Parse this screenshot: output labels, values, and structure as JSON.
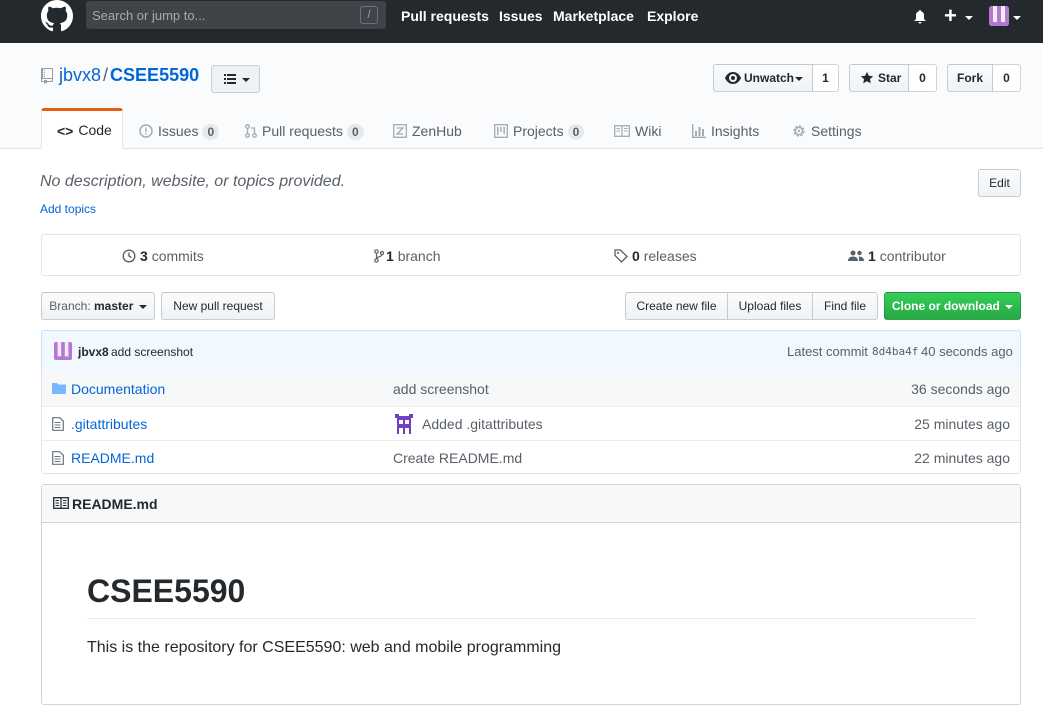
{
  "header": {
    "search_placeholder": "Search or jump to...",
    "search_shortcut": "/",
    "nav": [
      "Pull requests",
      "Issues",
      "Marketplace",
      "Explore"
    ],
    "plus_label": "+"
  },
  "repo": {
    "owner": "jbvx8",
    "separator": "/",
    "name": "CSEE5590",
    "watch_label": "Unwatch",
    "watch_count": "1",
    "star_label": "Star",
    "star_count": "0",
    "fork_label": "Fork",
    "fork_count": "0"
  },
  "tabs": [
    {
      "label": "Code",
      "icon": "code-icon"
    },
    {
      "label": "Issues",
      "count": "0",
      "icon": "issue-icon"
    },
    {
      "label": "Pull requests",
      "count": "0",
      "icon": "pull-request-icon"
    },
    {
      "label": "ZenHub",
      "icon": "zenhub-icon"
    },
    {
      "label": "Projects",
      "count": "0",
      "icon": "project-icon"
    },
    {
      "label": "Wiki",
      "icon": "book-icon"
    },
    {
      "label": "Insights",
      "icon": "graph-icon"
    },
    {
      "label": "Settings",
      "icon": "gear-icon"
    }
  ],
  "about": {
    "description": "No description, website, or topics provided.",
    "add_topics": "Add topics",
    "edit_label": "Edit"
  },
  "summary": {
    "commits_num": "3",
    "commits_label": "commits",
    "branch_num": "1",
    "branch_label": "branch",
    "releases_num": "0",
    "releases_label": "releases",
    "contributors_num": "1",
    "contributors_label": "contributor"
  },
  "toolbar": {
    "branch_prefix": "Branch:",
    "branch_name": "master",
    "new_pr": "New pull request",
    "create_file": "Create new file",
    "upload_files": "Upload files",
    "find_file": "Find file",
    "clone": "Clone or download"
  },
  "latest_commit": {
    "author": "jbvx8",
    "message": "add screenshot",
    "label": "Latest commit",
    "sha": "8d4ba4f",
    "age": "40 seconds ago"
  },
  "files": [
    {
      "name": "Documentation",
      "type": "folder",
      "message": "add screenshot",
      "age": "36 seconds ago"
    },
    {
      "name": ".gitattributes",
      "type": "file",
      "message": "Added .gitattributes",
      "age": "25 minutes ago"
    },
    {
      "name": "README.md",
      "type": "file",
      "message": "Create README.md",
      "age": "22 minutes ago"
    }
  ],
  "readme": {
    "filename": "README.md",
    "heading": "CSEE5590",
    "body": "This is the repository for CSEE5590: web and mobile programming"
  },
  "colors": {
    "header_bg": "#24292e",
    "link": "#0366d6",
    "tab_accent": "#e36209",
    "clone_button": "#28a745"
  }
}
